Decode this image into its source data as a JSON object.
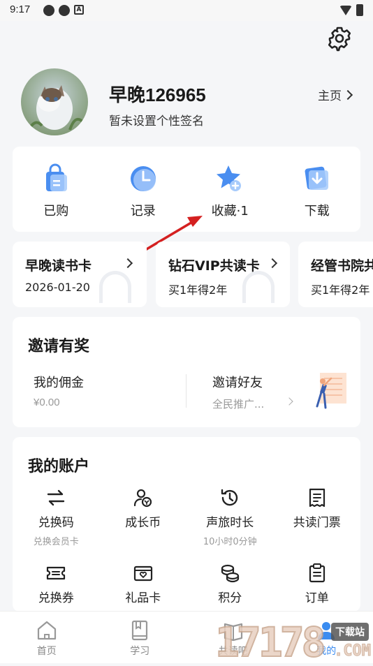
{
  "statusbar": {
    "time": "9:17",
    "icons": [
      "settings-dot-icon",
      "settings-dot-icon",
      "a-badge-icon",
      "wifi-icon",
      "battery-icon"
    ]
  },
  "profile": {
    "nickname": "早晚126965",
    "signature": "暂未设置个性签名",
    "homepage_label": "主页"
  },
  "quick_actions": [
    {
      "label": "已购",
      "icon": "purchased-bag-icon"
    },
    {
      "label": "记录",
      "icon": "history-clock-icon"
    },
    {
      "label": "收藏·1",
      "icon": "favorite-star-icon"
    },
    {
      "label": "下载",
      "icon": "download-icon"
    }
  ],
  "vip_cards": [
    {
      "title": "早晚读书卡",
      "sub": "2026-01-20"
    },
    {
      "title": "钻石VIP共读卡",
      "sub": "买1年得2年"
    },
    {
      "title": "经管书院共",
      "sub": "买1年得2年"
    }
  ],
  "invite": {
    "title": "邀请有奖",
    "commission_label": "我的佣金",
    "commission_value": "¥0.00",
    "friends_label": "邀请好友",
    "friends_sub": "全民推广..."
  },
  "account": {
    "title": "我的账户",
    "items": [
      {
        "label": "兑换码",
        "sub": "兑换会员卡",
        "icon": "exchange-arrows-icon"
      },
      {
        "label": "成长币",
        "sub": "",
        "icon": "growth-coin-icon"
      },
      {
        "label": "声旅时长",
        "sub": "10小时0分钟",
        "icon": "time-history-icon"
      },
      {
        "label": "共读门票",
        "sub": "",
        "icon": "ticket-receipt-icon"
      },
      {
        "label": "兑换券",
        "sub": "",
        "icon": "coupon-icon"
      },
      {
        "label": "礼品卡",
        "sub": "",
        "icon": "gift-card-icon"
      },
      {
        "label": "积分",
        "sub": "",
        "icon": "points-coins-icon"
      },
      {
        "label": "订单",
        "sub": "",
        "icon": "order-clipboard-icon"
      }
    ]
  },
  "tabs": [
    {
      "label": "首页",
      "icon": "home-icon"
    },
    {
      "label": "学习",
      "icon": "book-icon"
    },
    {
      "label": "共读吧",
      "icon": "group-read-icon"
    },
    {
      "label": "我的",
      "icon": "profile-icon"
    }
  ],
  "watermark": {
    "number": "17178",
    "suffix": ".COM",
    "badge": "下载站"
  }
}
